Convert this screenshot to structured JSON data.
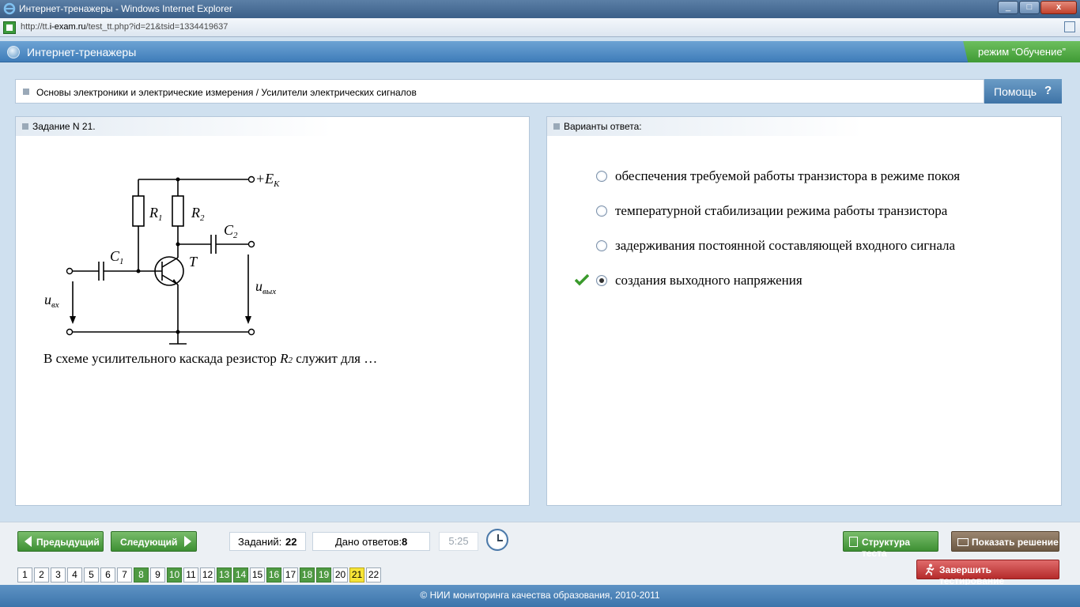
{
  "window": {
    "title": "Интернет-тренажеры - Windows Internet Explorer",
    "url_prefix": "http://tt.",
    "url_domain": "i-exam.ru",
    "url_path": "/test_tt.php?id=21&tsid=1334419637"
  },
  "app": {
    "title": "Интернет-тренажеры",
    "mode": "режим “Обучение”"
  },
  "breadcrumb": "Основы электроники и электрические измерения / Усилители электрических сигналов",
  "help_label": "Помощь",
  "help_icon": "?",
  "task": {
    "header": "Задание N 21.",
    "question_before": "В схеме усилительного каскада резистор ",
    "question_var": "R",
    "question_sub": "2",
    "question_after": "  служит для …",
    "circuit_labels": {
      "ek": "+E",
      "ek_sub": "K",
      "r1": "R",
      "r1_sub": "1",
      "r2": "R",
      "r2_sub": "2",
      "c1": "C",
      "c1_sub": "1",
      "c2": "C",
      "c2_sub": "2",
      "t": "T",
      "uin": "u",
      "uin_sub": "вх",
      "uout": "u",
      "uout_sub": "вых"
    }
  },
  "answers": {
    "header": "Варианты ответа:",
    "options": [
      {
        "text": "обеспечения требуемой работы транзистора в режиме покоя",
        "selected": false
      },
      {
        "text": "температурной стабилизации режима работы транзистора",
        "selected": false
      },
      {
        "text": "задерживания постоянной составляющей входного сигнала",
        "selected": false
      },
      {
        "text": "создания выходного напряжения",
        "selected": true
      }
    ]
  },
  "nav": {
    "prev": "Предыдущий",
    "next": "Следующий",
    "tasks_label": "Заданий:",
    "tasks_count": "22",
    "answers_label": "Дано ответов:",
    "answers_count": "8",
    "timer": "5:25",
    "structure": "Структура теста",
    "solution": "Показать решение",
    "finish": "Завершить тестирование"
  },
  "pages": [
    {
      "n": "1",
      "state": "none"
    },
    {
      "n": "2",
      "state": "none"
    },
    {
      "n": "3",
      "state": "none"
    },
    {
      "n": "4",
      "state": "none"
    },
    {
      "n": "5",
      "state": "none"
    },
    {
      "n": "6",
      "state": "none"
    },
    {
      "n": "7",
      "state": "none"
    },
    {
      "n": "8",
      "state": "answered"
    },
    {
      "n": "9",
      "state": "none"
    },
    {
      "n": "10",
      "state": "answered"
    },
    {
      "n": "11",
      "state": "none"
    },
    {
      "n": "12",
      "state": "none"
    },
    {
      "n": "13",
      "state": "answered"
    },
    {
      "n": "14",
      "state": "answered"
    },
    {
      "n": "15",
      "state": "none"
    },
    {
      "n": "16",
      "state": "answered"
    },
    {
      "n": "17",
      "state": "none"
    },
    {
      "n": "18",
      "state": "answered"
    },
    {
      "n": "19",
      "state": "answered"
    },
    {
      "n": "20",
      "state": "none"
    },
    {
      "n": "21",
      "state": "current"
    },
    {
      "n": "22",
      "state": "none"
    }
  ],
  "footer": "© НИИ мониторинга качества образования, 2010-2011",
  "colors": {
    "answered": "#4f9a43",
    "current": "#f6e437",
    "header_blue": "#3f7db9",
    "mode_green": "#3f9a35"
  }
}
